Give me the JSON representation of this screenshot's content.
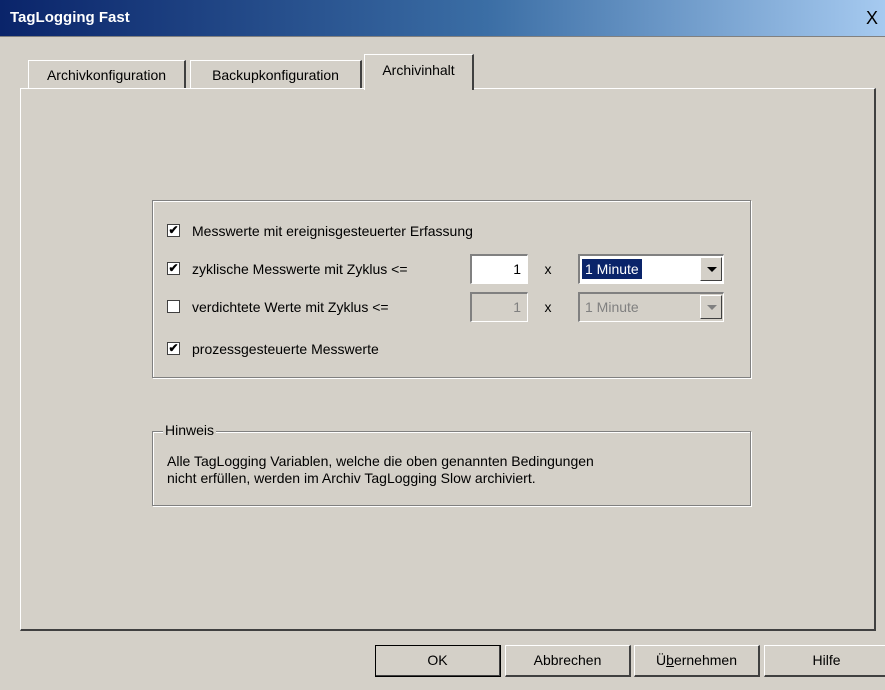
{
  "window": {
    "title": "TagLogging Fast",
    "close_label": "X"
  },
  "tabs": [
    {
      "label": "Archivkonfiguration",
      "active": false
    },
    {
      "label": "Backupkonfiguration",
      "active": false
    },
    {
      "label": "Archivinhalt",
      "active": true
    }
  ],
  "options": {
    "event_values": {
      "label": "Messwerte mit ereignisgesteuerter Erfassung",
      "checked": true
    },
    "cyclic_values": {
      "label": "zyklische Messwerte mit Zyklus <=",
      "checked": true,
      "factor": "1",
      "x": "x",
      "unit": "1 Minute",
      "unit_selected": true
    },
    "compressed_values": {
      "label": "verdichtete Werte mit Zyklus <=",
      "checked": false,
      "factor": "1",
      "x": "x",
      "unit": "1 Minute",
      "disabled": true
    },
    "process_values": {
      "label": "prozessgesteuerte Messwerte",
      "checked": true
    }
  },
  "hint": {
    "legend": "Hinweis",
    "line1": "Alle TagLogging Variablen, welche die oben genannten Bedingungen",
    "line2": "nicht erfüllen, werden im Archiv TagLogging Slow archiviert."
  },
  "buttons": {
    "ok": "OK",
    "cancel": "Abbrechen",
    "apply_pre": "Ü",
    "apply_under": "b",
    "apply_post": "ernehmen",
    "help": "Hilfe"
  },
  "check_mark": "✔"
}
